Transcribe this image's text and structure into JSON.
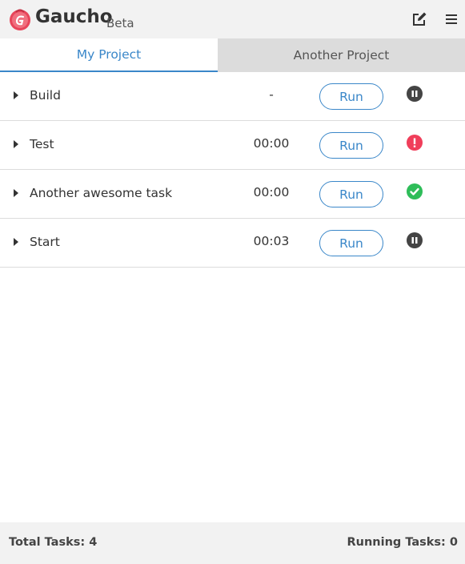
{
  "app": {
    "name": "Gaucho",
    "badge": "Beta",
    "logo_icon": "gaucho-logo",
    "accent_color": "#3a87c9"
  },
  "header": {
    "edit_icon": "edit-icon",
    "menu_icon": "hamburger-menu-icon"
  },
  "tabs": [
    {
      "label": "My Project",
      "active": true
    },
    {
      "label": "Another Project",
      "active": false
    }
  ],
  "tasks": [
    {
      "name": "Build",
      "time": "-",
      "run_label": "Run",
      "status": "paused",
      "status_icon": "pause-icon",
      "status_color": "#444444"
    },
    {
      "name": "Test",
      "time": "00:00",
      "run_label": "Run",
      "status": "error",
      "status_icon": "error-icon",
      "status_color": "#f03e5a"
    },
    {
      "name": "Another awesome task",
      "time": "00:00",
      "run_label": "Run",
      "status": "success",
      "status_icon": "check-icon",
      "status_color": "#2ebd59"
    },
    {
      "name": "Start",
      "time": "00:03",
      "run_label": "Run",
      "status": "paused",
      "status_icon": "pause-icon",
      "status_color": "#444444"
    }
  ],
  "footer": {
    "total_tasks": "Total Tasks: 4",
    "running_tasks": "Running Tasks: 0"
  }
}
